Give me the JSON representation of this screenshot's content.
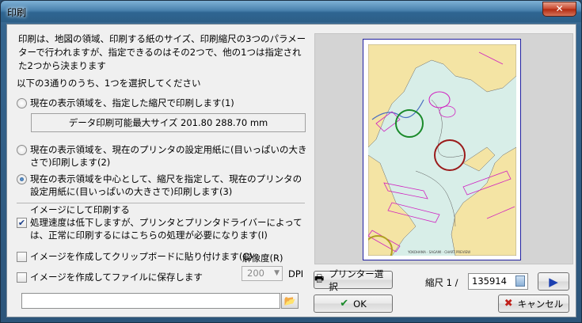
{
  "window": {
    "title": "印刷",
    "close_glyph": "✕"
  },
  "description": "印刷は、地図の領域、印刷する紙のサイズ、印刷縮尺の3つのパラメーターで行われますが、指定できるのはその2つで、他の1つは指定された2つから決まります",
  "subheading": "以下の3通りのうち、1つを選択してください",
  "options": [
    {
      "label": "現在の表示領域を、指定した縮尺で印刷します(1)",
      "selected": false
    },
    {
      "label": "現在の表示領域を、現在のプリンタの設定用紙に(目いっぱいの大きさで)印刷します(2)",
      "selected": false
    },
    {
      "label": "現在の表示領域を中心として、縮尺を指定して、現在のプリンタの設定用紙に(目いっぱいの大きさで)印刷します(3)",
      "selected": true
    }
  ],
  "info_box": "データ印刷可能最大サイズ  201.80   288.70  mm",
  "image_print": {
    "label": "イメージにして印刷する",
    "note": "処理速度は低下しますが、プリンタとプリンタドライバーによっては、正常に印刷するにはこちらの処理が必要になります(I)",
    "checked": true
  },
  "clipboard": {
    "label": "イメージを作成してクリップボードに貼り付けます(C)",
    "checked": false
  },
  "save_file": {
    "label": "イメージを作成してファイルに保存します",
    "checked": false
  },
  "resolution": {
    "label": "解像度(R)",
    "value": "200",
    "unit": "DPI"
  },
  "path": {
    "value": ""
  },
  "printer_button": "プリンター選択",
  "scale": {
    "label": "縮尺 1 /",
    "value": "135914"
  },
  "ok_button": "OK",
  "cancel_button": "キャンセル",
  "preview": {
    "footer_text": "YOKOHAMA ·  SAGAMI · CHART PREVIEW"
  },
  "colors": {
    "land": "#f4e4a4",
    "water": "#d8eee8",
    "route": "#d020c0",
    "circle": "#9a1a1a",
    "green": "#1a8a2a",
    "accent": "#1b4f8a"
  }
}
